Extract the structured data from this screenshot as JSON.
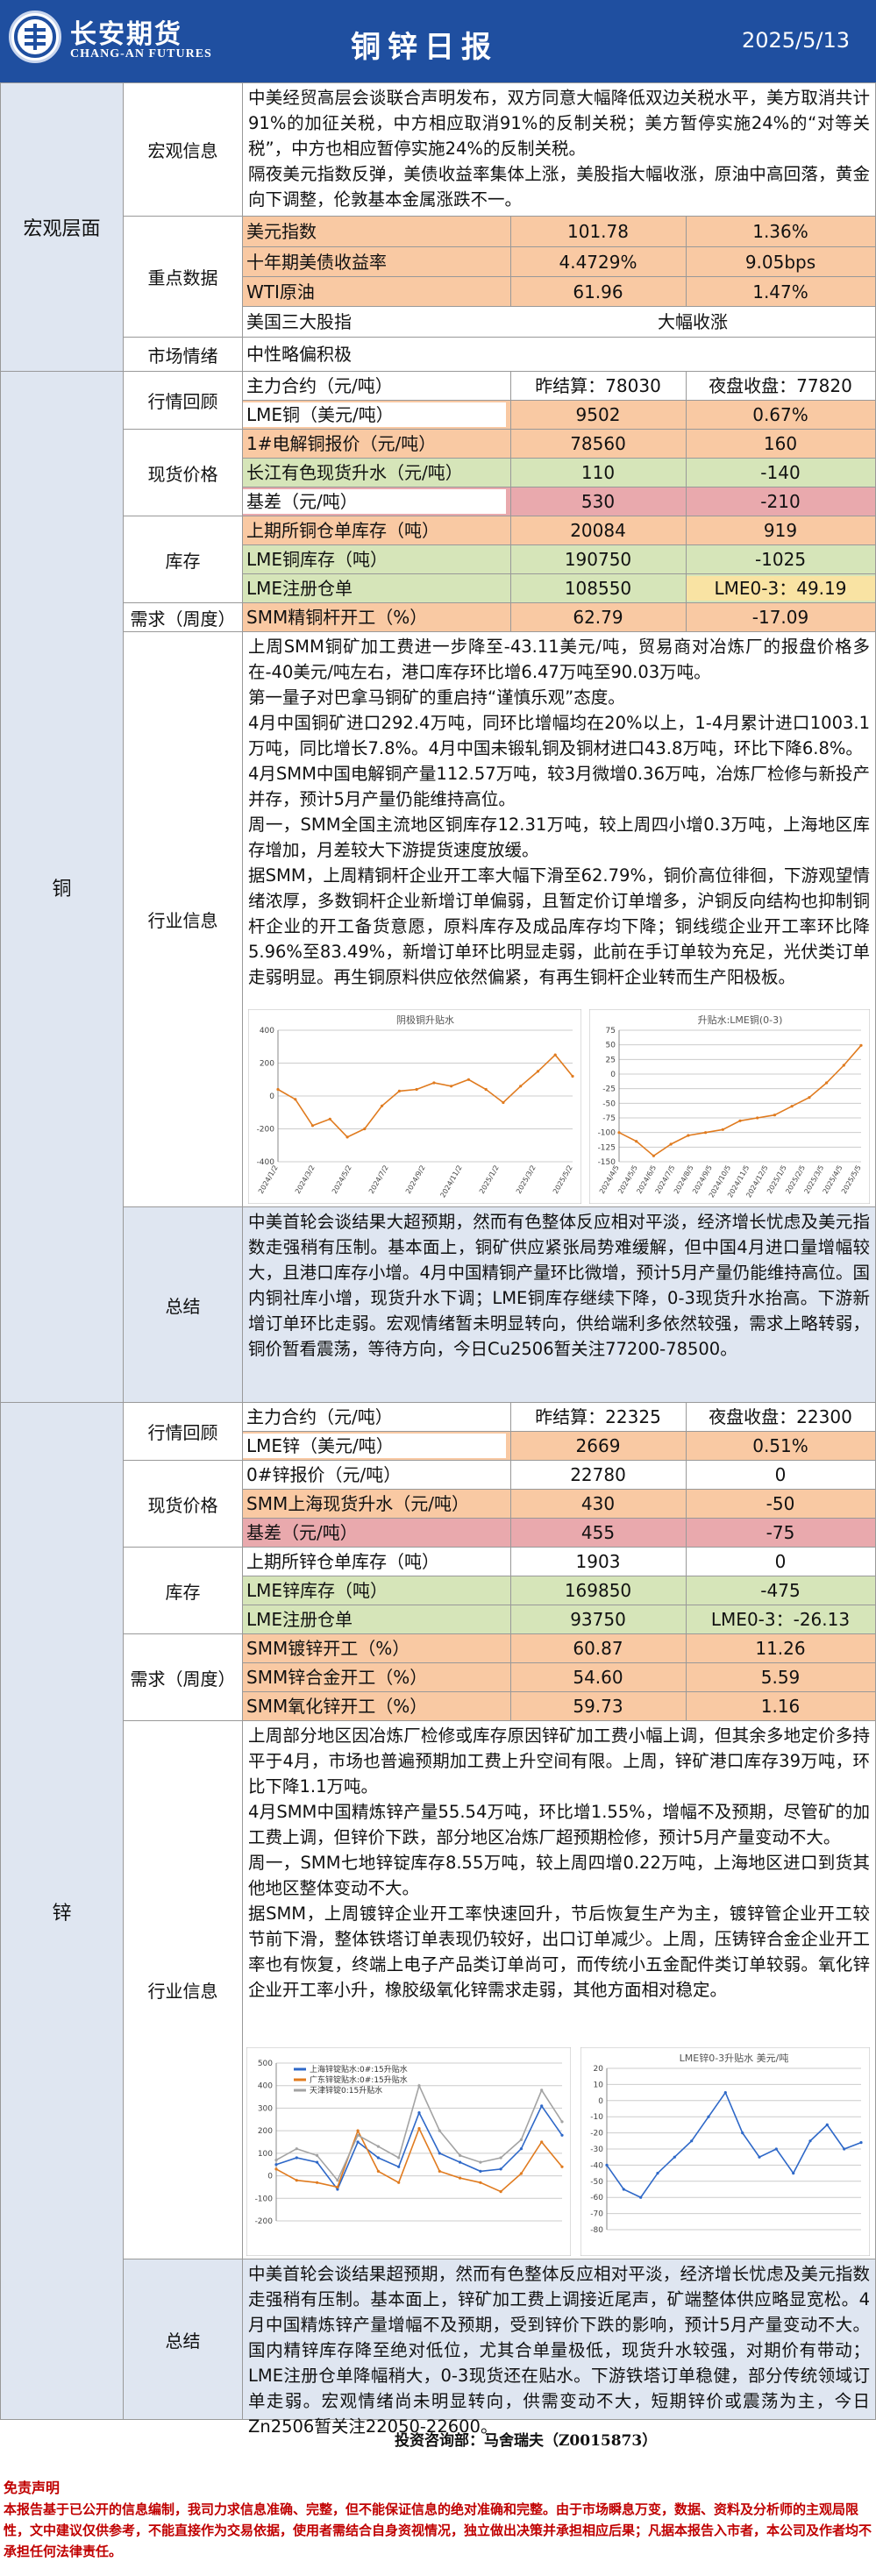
{
  "header": {
    "brand": "长安期货",
    "brand_en": "CHANG-AN FUTURES",
    "title": "铜锌日报",
    "date": "2025/5/13"
  },
  "macro": {
    "section": "宏观层面",
    "info_label": "宏观信息",
    "info_text": "中美经贸高层会谈联合声明发布，双方同意大幅降低双边关税水平，美方取消共计91%的加征关税，中方相应取消91%的反制关税；美方暂停实施24%的“对等关税”，中方也相应暂停实施24%的反制关税。\n隔夜美元指数反弹，美债收益率集体上涨，美股指大幅收涨，原油中高回落，黄金向下调整，伦敦基本金属涨跌不一。",
    "key_label": "重点数据",
    "rows": [
      {
        "n": "美元指数",
        "v1": "101.78",
        "v2": "1.36%"
      },
      {
        "n": "十年期美债收益率",
        "v1": "4.4729%",
        "v2": "9.05bps"
      },
      {
        "n": "WTI原油",
        "v1": "61.96",
        "v2": "1.47%"
      },
      {
        "n": "美国三大股指",
        "v1": "",
        "v2": "大幅收涨"
      }
    ],
    "mood_label": "市场情绪",
    "mood": "中性略偏积极"
  },
  "copper": {
    "section": "铜",
    "market_label": "行情回顾",
    "r1": {
      "n": "主力合约（元/吨）",
      "v1": "昨结算：78030",
      "v2": "夜盘收盘：77820"
    },
    "r2": {
      "n": "LME铜（美元/吨）",
      "v1": "9502",
      "v2": "0.67%"
    },
    "spot_label": "现货价格",
    "r3": {
      "n": "1#电解铜报价（元/吨）",
      "v1": "78560",
      "v2": "160"
    },
    "r4": {
      "n": "长江有色现货升水（元/吨）",
      "v1": "110",
      "v2": "-140"
    },
    "r5": {
      "n": "基差（元/吨）",
      "v1": "530",
      "v2": "-210"
    },
    "stock_label": "库存",
    "r6": {
      "n": "上期所铜仓单库存（吨）",
      "v1": "20084",
      "v2": "919"
    },
    "r7": {
      "n": "LME铜库存（吨）",
      "v1": "190750",
      "v2": "-1025"
    },
    "r8": {
      "n": "LME注册仓单",
      "v1": "108550",
      "v2": "LME0-3：49.19"
    },
    "demand_label": "需求（周度）",
    "r9": {
      "n": "SMM精铜杆开工（%）",
      "v1": "62.79",
      "v2": "-17.09"
    },
    "industry_label": "行业信息",
    "industry_text": "上周SMM铜矿加工费进一步降至-43.11美元/吨，贸易商对冶炼厂的报盘价格多在-40美元/吨左右，港口库存环比增6.47万吨至90.03万吨。\n第一量子对巴拿马铜矿的重启持“谨慎乐观”态度。\n4月中国铜矿进口292.4万吨，同环比增幅均在20%以上，1-4月累计进口1003.1万吨，同比增长7.8%。4月中国未锻轧铜及铜材进口43.8万吨，环比下降6.8%。\n4月SMM中国电解铜产量112.57万吨，较3月微增0.36万吨，冶炼厂检修与新投产并存，预计5月产量仍能维持高位。\n周一，SMM全国主流地区铜库存12.31万吨，较上周四小增0.3万吨，上海地区库存增加，月差较大下游提货速度放缓。\n据SMM，上周精铜杆企业开工率大幅下滑至62.79%，铜价高位徘徊，下游观望情绪浓厚，多数铜杆企业新增订单偏弱，且暂定价订单增多，沪铜反向结构也抑制铜杆企业的开工备货意愿，原料库存及成品库存均下降；铜线缆企业开工率环比降5.96%至83.49%，新增订单环比明显走弱，此前在手订单较为充足，光伏类订单走弱明显。再生铜原料供应依然偏紧，有再生铜杆企业转而生产阳极板。",
    "chart1_title": "阴极铜升贴水",
    "chart2_title": "升贴水:LME铜(0-3)",
    "summary_label": "总结",
    "summary_text": "中美首轮会谈结果大超预期，然而有色整体反应相对平淡，经济增长忧虑及美元指数走强稍有压制。基本面上，铜矿供应紧张局势难缓解，但中国4月进口量增幅较大，且港口库存小增。4月中国精铜产量环比微增，预计5月产量仍能维持高位。国内铜社库小增，现货升水下调；LME铜库存继续下降，0-3现货升水抬高。下游新增订单环比走弱。宏观情绪暂未明显转向，供给端利多依然较强，需求上略转弱，铜价暂看震荡，等待方向，今日Cu2506暂关注77200-78500。",
    "chart_data": [
      {
        "type": "line",
        "title": "阴极铜升贴水",
        "ylim": [
          -400,
          400
        ],
        "y_ticks": [
          "-400",
          "-200",
          "0",
          "200",
          "400"
        ],
        "x_ticks": [
          "2024/1/2",
          "2024/3/2",
          "2024/5/2",
          "2024/7/2",
          "2024/9/2",
          "2024/11/2",
          "2025/1/2",
          "2025/3/2",
          "2025/5/2"
        ],
        "x": [
          "2024/1/2",
          "2024/2/1",
          "2024/3/2",
          "2024/4/1",
          "2024/5/2",
          "2024/6/1",
          "2024/7/2",
          "2024/8/1",
          "2024/9/2",
          "2024/10/2",
          "2024/11/2",
          "2024/12/2",
          "2025/1/2",
          "2025/2/1",
          "2025/3/2",
          "2025/4/1",
          "2025/4/15",
          "2025/5/2"
        ],
        "values": [
          40,
          -20,
          -180,
          -140,
          -250,
          -200,
          -60,
          30,
          40,
          80,
          60,
          100,
          40,
          -40,
          60,
          150,
          250,
          120
        ]
      },
      {
        "type": "line",
        "title": "升贴水:LME铜(0-3)",
        "ylim": [
          -150,
          75
        ],
        "y_ticks": [
          "-150",
          "-125",
          "-100",
          "-75",
          "-50",
          "-25",
          "0",
          "25",
          "50",
          "75"
        ],
        "x_ticks": [
          "2024/4/5",
          "2024/5/5",
          "2024/6/5",
          "2024/7/5",
          "2024/8/5",
          "2024/9/5",
          "2024/10/5",
          "2024/11/5",
          "2024/12/5",
          "2025/1/5",
          "2025/2/5",
          "2025/3/5",
          "2025/4/5",
          "2025/5/5"
        ],
        "x": [
          "2024/4/5",
          "2024/5/5",
          "2024/5/20",
          "2024/6/5",
          "2024/7/5",
          "2024/8/5",
          "2024/9/5",
          "2024/10/5",
          "2024/11/5",
          "2024/12/5",
          "2025/1/5",
          "2025/2/5",
          "2025/3/5",
          "2025/4/5",
          "2025/5/5"
        ],
        "values": [
          -100,
          -115,
          -140,
          -120,
          -105,
          -100,
          -95,
          -80,
          -75,
          -70,
          -55,
          -40,
          -15,
          15,
          49
        ]
      }
    ]
  },
  "zinc": {
    "section": "锌",
    "market_label": "行情回顾",
    "r1": {
      "n": "主力合约（元/吨）",
      "v1": "昨结算：22325",
      "v2": "夜盘收盘：22300"
    },
    "r2": {
      "n": "LME锌（美元/吨）",
      "v1": "2669",
      "v2": "0.51%"
    },
    "spot_label": "现货价格",
    "r3": {
      "n": "0#锌报价（元/吨）",
      "v1": "22780",
      "v2": "0"
    },
    "r4": {
      "n": "SMM上海现货升水（元/吨）",
      "v1": "430",
      "v2": "-50"
    },
    "r5": {
      "n": "基差（元/吨）",
      "v1": "455",
      "v2": "-75"
    },
    "stock_label": "库存",
    "r6": {
      "n": "上期所锌仓单库存（吨）",
      "v1": "1903",
      "v2": "0"
    },
    "r7": {
      "n": "LME锌库存（吨）",
      "v1": "169850",
      "v2": "-475"
    },
    "r8": {
      "n": "LME注册仓单",
      "v1": "93750",
      "v2": "LME0-3：-26.13"
    },
    "demand_label": "需求（周度）",
    "r9": {
      "n": "SMM镀锌开工（%）",
      "v1": "60.87",
      "v2": "11.26"
    },
    "r10": {
      "n": "SMM锌合金开工（%）",
      "v1": "54.60",
      "v2": "5.59"
    },
    "r11": {
      "n": "SMM氧化锌开工（%）",
      "v1": "59.73",
      "v2": "1.16"
    },
    "industry_label": "行业信息",
    "industry_text": "上周部分地区因冶炼厂检修或库存原因锌矿加工费小幅上调，但其余多地定价多持平于4月，市场也普遍预期加工费上升空间有限。上周，锌矿港口库存39万吨，环比下降1.1万吨。\n4月SMM中国精炼锌产量55.54万吨，环比增1.55%，增幅不及预期，尽管矿的加工费上调，但锌价下跌，部分地区冶炼厂超预期检修，预计5月产量变动不大。\n周一，SMM七地锌锭库存8.55万吨，较上周四增0.22万吨，上海地区进口到货其他地区整体变动不大。\n据SMM，上周镀锌企业开工率快速回升，节后恢复生产为主，镀锌管企业开工较节前下滑，整体铁塔订单表现仍较好，出口订单减少。上周，压铸锌合金企业开工率也有恢复，终端上电子产品类订单尚可，而传统小五金配件类订单较弱。氧化锌企业开工率小升，橡胶级氧化锌需求走弱，其他方面相对稳定。",
    "chart1_legend": [
      "上海锌锭贴水:0#:15升贴水",
      "广东锌锭贴水:0#:15升贴水",
      "天津锌锭0:15升贴水"
    ],
    "chart2_title": "LME锌0-3升贴水 美元/吨",
    "summary_label": "总结",
    "summary_text": "中美首轮会谈结果超预期，然而有色整体反应相对平淡，经济增长忧虑及美元指数走强稍有压制。基本面上，锌矿加工费上调接近尾声，矿端整体供应略显宽松。4月中国精炼锌产量增幅不及预期，受到锌价下跌的影响，预计5月产量变动不大。国内精锌库存降至绝对低位，尤其合单量极低，现货升水较强，对期价有带动；LME注册仓单降幅稍大，0-3现货还在贴水。下游铁塔订单稳健，部分传统领域订单走弱。宏观情绪尚未明显转向，供需变动不大，短期锌价或震荡为主，今日Zn2506暂关注22050-22600。",
    "chart_data": [
      {
        "type": "line",
        "title": "",
        "ylim": [
          -200,
          500
        ],
        "y_ticks": [
          "-200",
          "-100",
          "0",
          "100",
          "200",
          "300",
          "400",
          "500"
        ],
        "series": [
          {
            "name": "上海锌锭贴水:0#:15升贴水",
            "values": [
              50,
              80,
              60,
              -60,
              150,
              80,
              40,
              280,
              100,
              60,
              20,
              30,
              120,
              310,
              180
            ]
          },
          {
            "name": "广东锌锭贴水:0#:15升贴水",
            "values": [
              30,
              -20,
              -30,
              -50,
              200,
              20,
              -30,
              210,
              20,
              -10,
              -30,
              -70,
              10,
              150,
              40
            ]
          },
          {
            "name": "天津锌锭0:15升贴水",
            "values": [
              70,
              120,
              90,
              -20,
              180,
              130,
              80,
              400,
              200,
              90,
              60,
              80,
              160,
              380,
              240
            ]
          }
        ]
      },
      {
        "type": "line",
        "title": "LME锌0-3升贴水 美元/吨",
        "ylim": [
          -80,
          20
        ],
        "y_ticks": [
          "-80",
          "-70",
          "-60",
          "-50",
          "-40",
          "-30",
          "-20",
          "-10",
          "0",
          "10",
          "20"
        ],
        "values": [
          -40,
          -55,
          -60,
          -45,
          -35,
          -25,
          -10,
          5,
          -20,
          -35,
          -30,
          -45,
          -25,
          -15,
          -30,
          -26
        ]
      }
    ]
  },
  "footer": {
    "advisor": "投资咨询部：马舍瑞夫（Z0015873）",
    "disc_title": "免责声明",
    "disc_text": "本报告基于已公开的信息编制，我司力求信息准确、完整，但不能保证信息的绝对准确和完整。由于市场瞬息万变，数据、资料及分析师的主观局限性，文中建议仅供参考，不能直接作为交易依据，使用者需结合自身资视情况，独立做出决策并承担相应后果；凡据本报告入市者，本公司及作者均不承担任何法律责任。"
  },
  "colors": {
    "header": "#1f4fa0",
    "orange": "#f9c9a3",
    "green": "#d6e5b9",
    "pink": "#e9a9ad",
    "section": "#dfe6f1"
  }
}
